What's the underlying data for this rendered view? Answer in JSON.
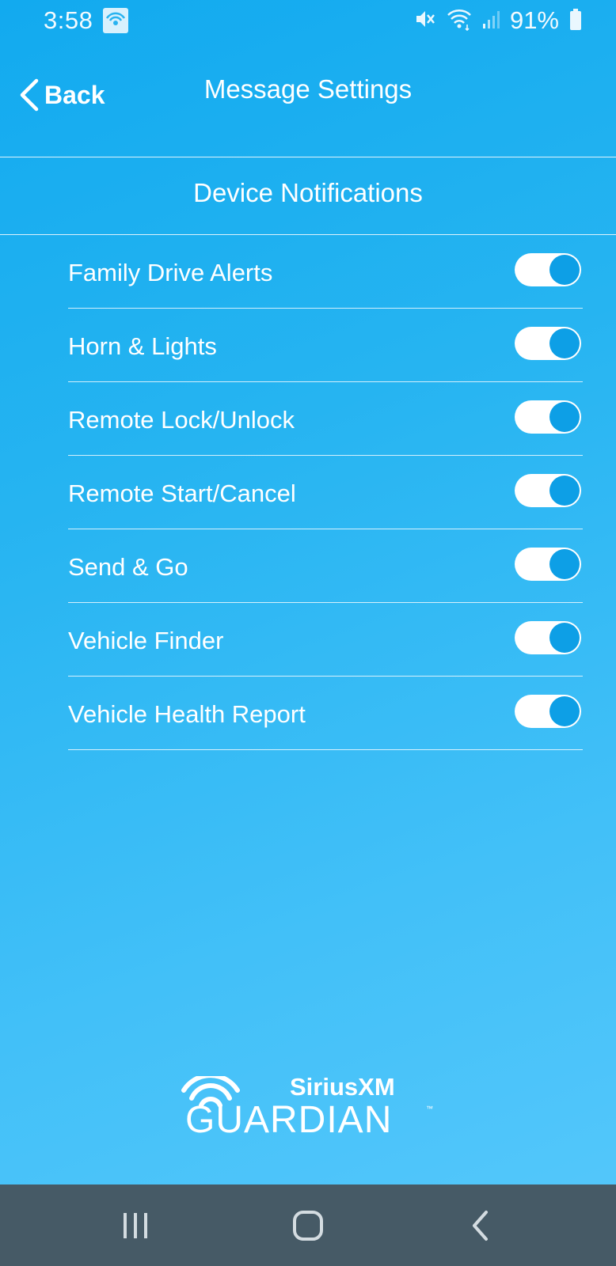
{
  "status_bar": {
    "time": "3:58",
    "battery_percent": "91%"
  },
  "header": {
    "back_label": "Back",
    "title": "Message Settings"
  },
  "section": {
    "title": "Device Notifications"
  },
  "settings": [
    {
      "label": "Family Drive Alerts",
      "enabled": true
    },
    {
      "label": "Horn & Lights",
      "enabled": true
    },
    {
      "label": "Remote Lock/Unlock",
      "enabled": true
    },
    {
      "label": "Remote Start/Cancel",
      "enabled": true
    },
    {
      "label": "Send & Go",
      "enabled": true
    },
    {
      "label": "Vehicle Finder",
      "enabled": true
    },
    {
      "label": "Vehicle Health Report",
      "enabled": true
    }
  ],
  "logo": {
    "brand": "SiriusXM",
    "product": "GUARDIAN",
    "trademark": "™"
  },
  "colors": {
    "background_top": "#12aaef",
    "background_bottom": "#56c8fb",
    "toggle_knob": "#0d9fe6",
    "nav_bar": "#465a66"
  },
  "icons": {
    "status": [
      "hotspot-icon",
      "mute-icon",
      "wifi-icon",
      "signal-icon",
      "battery-icon"
    ],
    "nav": [
      "recent-apps-icon",
      "home-icon",
      "nav-back-icon"
    ]
  }
}
